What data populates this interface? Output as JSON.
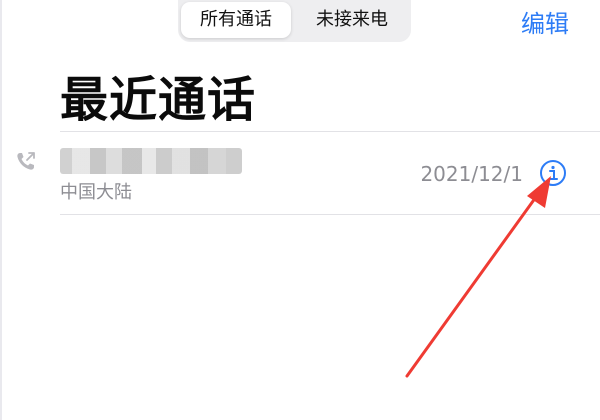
{
  "segments": {
    "all_calls": "所有通话",
    "missed_calls": "未接来电"
  },
  "header": {
    "edit_label": "编辑"
  },
  "page_title": "最近通话",
  "recent_calls": [
    {
      "type": "outgoing",
      "caller_label": "中国大陆",
      "date": "2021/12/1"
    }
  ],
  "icons": {
    "call_type": "outgoing-call-icon",
    "detail": "info-icon"
  },
  "colors": {
    "accent": "#2d7cf6",
    "secondary_text": "#8d8d93",
    "annotation": "#ef3b33"
  }
}
